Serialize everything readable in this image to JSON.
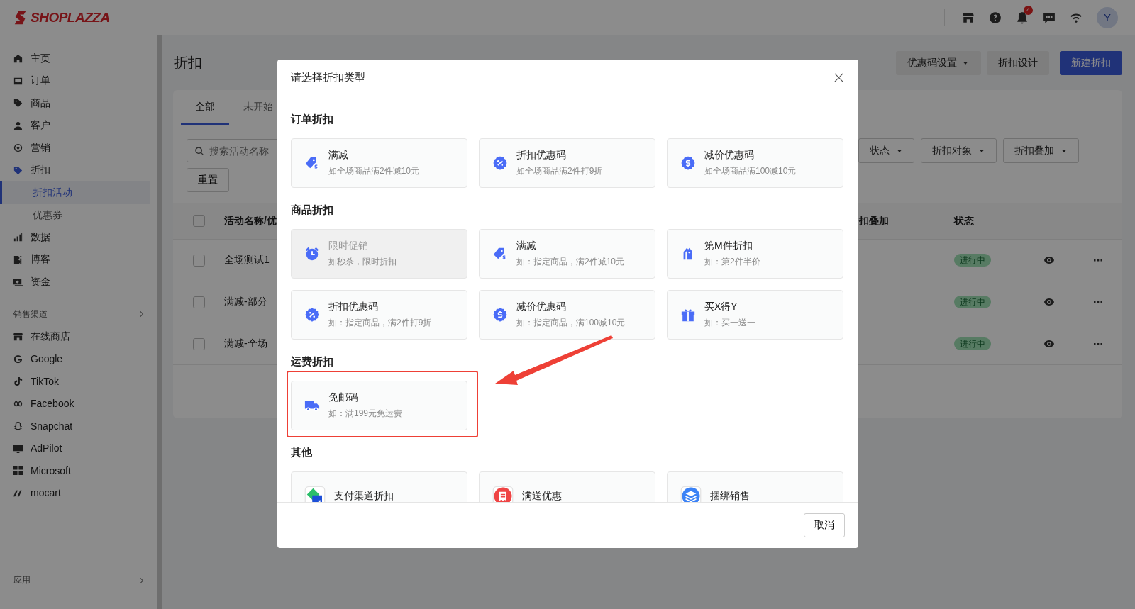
{
  "topbar": {
    "logo": "SHOPLAZZA",
    "notification_count": "4",
    "avatar": "Y"
  },
  "sidebar": {
    "items": [
      {
        "label": "主页",
        "selected": false
      },
      {
        "label": "订单",
        "selected": false
      },
      {
        "label": "商品",
        "selected": false
      },
      {
        "label": "客户",
        "selected": false
      },
      {
        "label": "营销",
        "selected": false
      },
      {
        "label": "折扣",
        "selected": false,
        "children": [
          {
            "label": "折扣活动",
            "selected": true
          },
          {
            "label": "优惠券",
            "selected": false
          }
        ]
      },
      {
        "label": "数据",
        "selected": false
      },
      {
        "label": "博客",
        "selected": false
      },
      {
        "label": "资金",
        "selected": false
      }
    ],
    "sections": [
      {
        "title": "销售渠道",
        "items": [
          {
            "label": "在线商店",
            "selected": false
          },
          {
            "label": "Google",
            "selected": false
          },
          {
            "label": "TikTok",
            "selected": false
          },
          {
            "label": "Facebook",
            "selected": false
          },
          {
            "label": "Snapchat",
            "selected": false
          },
          {
            "label": "AdPilot",
            "selected": false
          },
          {
            "label": "Microsoft",
            "selected": false
          },
          {
            "label": "mocart",
            "selected": false
          }
        ]
      },
      {
        "title": "应用"
      }
    ]
  },
  "page": {
    "title": "折扣",
    "header_buttons": [
      {
        "label": "优惠码设置",
        "kind": "dropdown"
      },
      {
        "label": "折扣设计",
        "kind": "plain"
      },
      {
        "label": "新建折扣",
        "kind": "primary"
      }
    ],
    "tabs": [
      {
        "label": "全部",
        "selected": true
      },
      {
        "label": "未开始",
        "selected": false
      }
    ],
    "search": {
      "placeholder": "搜索活动名称"
    },
    "filters": [
      "状态",
      "折扣对象",
      "折扣叠加"
    ],
    "reset_button": "重置",
    "table": {
      "all_checked": false,
      "columns": [
        "活动名称/优",
        "扣叠加",
        "状态"
      ],
      "rows": [
        {
          "name": "全场测试1",
          "status": "进行中",
          "checked": false
        },
        {
          "name": "满减-部分",
          "status": "进行中",
          "checked": false
        },
        {
          "name": "满减-全场",
          "status": "进行中",
          "checked": false
        }
      ]
    }
  },
  "dialog": {
    "title": "请选择折扣类型",
    "sections": [
      {
        "title": "订单折扣",
        "cards": [
          {
            "title": "满减",
            "desc": "如全场商品满2件减10元",
            "disabled": false,
            "highlighted": false
          },
          {
            "title": "折扣优惠码",
            "desc": "如全场商品满2件打9折",
            "disabled": false,
            "highlighted": false
          },
          {
            "title": "减价优惠码",
            "desc": "如全场商品满100减10元",
            "disabled": false,
            "highlighted": false
          }
        ]
      },
      {
        "title": "商品折扣",
        "cards": [
          {
            "title": "限时促销",
            "desc": "如秒杀，限时折扣",
            "disabled": true,
            "highlighted": false
          },
          {
            "title": "满减",
            "desc": "如：指定商品，满2件减10元",
            "disabled": false,
            "highlighted": false
          },
          {
            "title": "第M件折扣",
            "desc": "如：第2件半价",
            "disabled": false,
            "highlighted": false
          },
          {
            "title": "折扣优惠码",
            "desc": "如：指定商品，满2件打9折",
            "disabled": false,
            "highlighted": false
          },
          {
            "title": "减价优惠码",
            "desc": "如：指定商品，满100减10元",
            "disabled": false,
            "highlighted": false
          },
          {
            "title": "买X得Y",
            "desc": "如：买一送一",
            "disabled": false,
            "highlighted": false
          }
        ]
      },
      {
        "title": "运费折扣",
        "cards": [
          {
            "title": "免邮码",
            "desc": "如：满199元免运费",
            "disabled": false,
            "highlighted": true
          }
        ]
      },
      {
        "title": "其他",
        "cards": [
          {
            "title": "支付渠道折扣",
            "disabled": false,
            "highlighted": false
          },
          {
            "title": "满送优惠",
            "disabled": false,
            "highlighted": false
          },
          {
            "title": "捆绑销售",
            "disabled": false,
            "highlighted": false
          }
        ]
      }
    ],
    "cancel_button": "取消"
  }
}
